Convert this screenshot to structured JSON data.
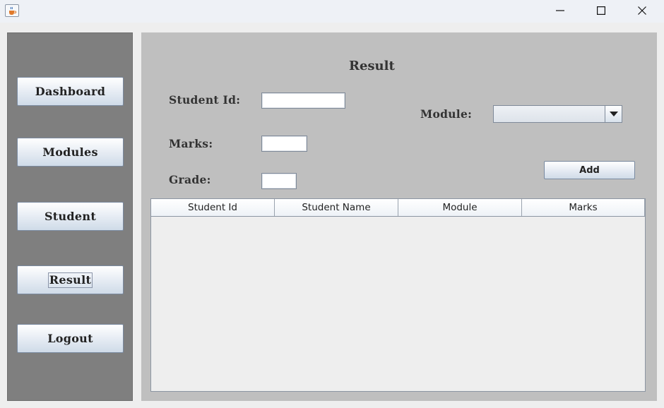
{
  "titlebar": {
    "icon": "java-cup-icon",
    "controls": {
      "minimize": "minimize-icon",
      "maximize": "maximize-icon",
      "close": "close-icon"
    }
  },
  "sidebar": {
    "items": [
      {
        "label": "Dashboard"
      },
      {
        "label": "Modules"
      },
      {
        "label": "Student"
      },
      {
        "label": "Result"
      },
      {
        "label": "Logout"
      }
    ]
  },
  "form": {
    "title": "Result",
    "student_id_label": "Student Id:",
    "student_id_value": "",
    "marks_label": "Marks:",
    "marks_value": "",
    "grade_label": "Grade:",
    "grade_value": "",
    "module_label": "Module:",
    "module_value": "",
    "add_label": "Add"
  },
  "table": {
    "columns": [
      "Student Id",
      "Student Name",
      "Module",
      "Marks"
    ],
    "rows": []
  },
  "colors": {
    "sidebar_bg": "#7f7f7f",
    "main_bg": "#bfbfbf",
    "button_gradient_bottom": "#cfdbe8"
  }
}
